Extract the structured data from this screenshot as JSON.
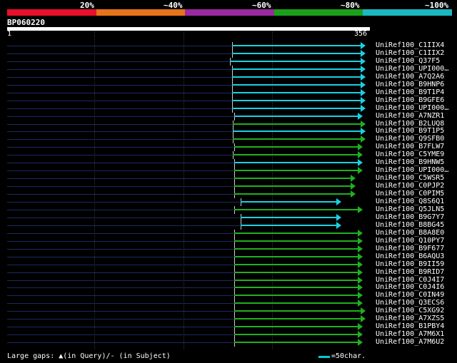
{
  "scale": {
    "labels": [
      "20%",
      "~40%",
      "~60%",
      "~80%",
      "~100%"
    ],
    "colors": [
      "#e8102a",
      "#e8741a",
      "#9a2aa0",
      "#1aa01a",
      "#1ab8c0"
    ]
  },
  "query": {
    "name": "BP060220",
    "start": "1",
    "end": "356"
  },
  "hits": [
    {
      "name": "UniRef100_C1IIX4",
      "start": 325,
      "end": 511,
      "color": "cyan"
    },
    {
      "name": "UniRef100_C1IIX2",
      "start": 325,
      "end": 511,
      "color": "cyan"
    },
    {
      "name": "UniRef100_Q37F5",
      "start": 322,
      "end": 511,
      "color": "cyan"
    },
    {
      "name": "UniRef100_UPI000…",
      "start": 325,
      "end": 511,
      "color": "cyan"
    },
    {
      "name": "UniRef100_A7Q2A6",
      "start": 325,
      "end": 511,
      "color": "cyan"
    },
    {
      "name": "UniRef100_B9HNP6",
      "start": 325,
      "end": 511,
      "color": "cyan"
    },
    {
      "name": "UniRef100_B9T1P4",
      "start": 325,
      "end": 511,
      "color": "cyan"
    },
    {
      "name": "UniRef100_B9GFE6",
      "start": 325,
      "end": 511,
      "color": "cyan"
    },
    {
      "name": "UniRef100_UPI000…",
      "start": 325,
      "end": 511,
      "color": "cyan"
    },
    {
      "name": "UniRef100_A7NZR1",
      "start": 328,
      "end": 507,
      "color": "cyan"
    },
    {
      "name": "UniRef100_B2LUQ8",
      "start": 326,
      "end": 511,
      "color": "green"
    },
    {
      "name": "UniRef100_B9T1P5",
      "start": 326,
      "end": 511,
      "color": "cyan"
    },
    {
      "name": "UniRef100_Q9SFB0",
      "start": 326,
      "end": 511,
      "color": "green"
    },
    {
      "name": "UniRef100_B7FLW7",
      "start": 328,
      "end": 507,
      "color": "green"
    },
    {
      "name": "UniRef100_C5YME9",
      "start": 326,
      "end": 507,
      "color": "green"
    },
    {
      "name": "UniRef100_B9HNW5",
      "start": 328,
      "end": 507,
      "color": "cyan"
    },
    {
      "name": "UniRef100_UPI000…",
      "start": 328,
      "end": 507,
      "color": "green"
    },
    {
      "name": "UniRef100_C5WSR5",
      "start": 328,
      "end": 497,
      "color": "green"
    },
    {
      "name": "UniRef100_C0PJP2",
      "start": 328,
      "end": 497,
      "color": "green"
    },
    {
      "name": "UniRef100_C0PIM5",
      "start": 328,
      "end": 497,
      "color": "green"
    },
    {
      "name": "UniRef100_Q8S6Q1",
      "start": 337,
      "end": 477,
      "color": "cyan"
    },
    {
      "name": "UniRef100_Q5JLN5",
      "start": 328,
      "end": 507,
      "color": "green"
    },
    {
      "name": "UniRef100_B9G7Y7",
      "start": 337,
      "end": 477,
      "color": "cyan"
    },
    {
      "name": "UniRef100_B8BG45",
      "start": 337,
      "end": 477,
      "color": "cyan"
    },
    {
      "name": "UniRef100_B8A8E0",
      "start": 328,
      "end": 507,
      "color": "green"
    },
    {
      "name": "UniRef100_Q10PY7",
      "start": 328,
      "end": 507,
      "color": "green"
    },
    {
      "name": "UniRef100_B9F677",
      "start": 328,
      "end": 507,
      "color": "green"
    },
    {
      "name": "UniRef100_B6AQU3",
      "start": 328,
      "end": 507,
      "color": "green"
    },
    {
      "name": "UniRef100_B9II59",
      "start": 328,
      "end": 507,
      "color": "green"
    },
    {
      "name": "UniRef100_B9RID7",
      "start": 328,
      "end": 507,
      "color": "green"
    },
    {
      "name": "UniRef100_C0J4I7",
      "start": 328,
      "end": 507,
      "color": "green"
    },
    {
      "name": "UniRef100_C0J4I6",
      "start": 328,
      "end": 507,
      "color": "green"
    },
    {
      "name": "UniRef100_C0IN49",
      "start": 328,
      "end": 507,
      "color": "green"
    },
    {
      "name": "UniRef100_Q3ECS6",
      "start": 328,
      "end": 507,
      "color": "green"
    },
    {
      "name": "UniRef100_C5XG92",
      "start": 328,
      "end": 511,
      "color": "green"
    },
    {
      "name": "UniRef100_A7XZS5",
      "start": 328,
      "end": 511,
      "color": "green"
    },
    {
      "name": "UniRef100_B1PBY4",
      "start": 328,
      "end": 507,
      "color": "green"
    },
    {
      "name": "UniRef100_A7M6X1",
      "start": 328,
      "end": 507,
      "color": "green"
    },
    {
      "name": "UniRef100_A7M6U2",
      "start": 328,
      "end": 507,
      "color": "green"
    }
  ],
  "colors": {
    "cyan": "#1ad0e0",
    "green": "#20b020",
    "cyan_arrow": "#1ad0e0",
    "green_arrow": "#20b020"
  },
  "footer": {
    "gaps_text": "Large gaps: ▲(in Query)/- (in Subject)",
    "legend_text": "=50char."
  }
}
